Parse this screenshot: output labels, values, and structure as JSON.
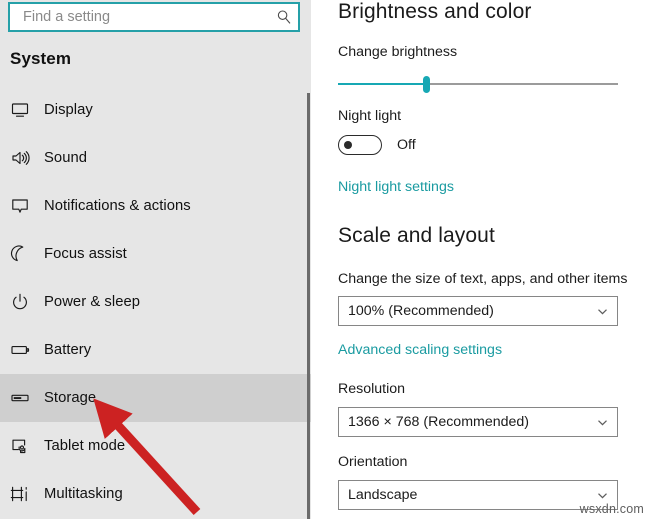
{
  "search": {
    "placeholder": "Find a setting",
    "value": "",
    "icon": "search-icon"
  },
  "sidebar": {
    "header": "System",
    "background_color": "#e6e6e6",
    "selected_background_color": "#cfcfcf",
    "items": [
      {
        "label": "Display",
        "icon": "monitor-icon",
        "selected": false
      },
      {
        "label": "Sound",
        "icon": "speaker-icon",
        "selected": false
      },
      {
        "label": "Notifications & actions",
        "icon": "speech-bubble-icon",
        "selected": false
      },
      {
        "label": "Focus assist",
        "icon": "moon-icon",
        "selected": false
      },
      {
        "label": "Power & sleep",
        "icon": "power-icon",
        "selected": false
      },
      {
        "label": "Battery",
        "icon": "battery-icon",
        "selected": false
      },
      {
        "label": "Storage",
        "icon": "drive-icon",
        "selected": true
      },
      {
        "label": "Tablet mode",
        "icon": "tablet-hand-icon",
        "selected": false
      },
      {
        "label": "Multitasking",
        "icon": "multitasking-icon",
        "selected": false
      }
    ]
  },
  "content": {
    "accent_color": "#17a8b4",
    "link_color": "#1a9ba1",
    "brightness_section": {
      "title": "Brightness and color",
      "slider_label": "Change brightness",
      "slider_percent": 32,
      "night_light_label": "Night light",
      "night_light_state": "Off",
      "night_light_on": false,
      "night_light_link": "Night light settings"
    },
    "scale_section": {
      "title": "Scale and layout",
      "scale_label": "Change the size of text, apps, and other items",
      "scale_value": "100% (Recommended)",
      "advanced_link": "Advanced scaling settings",
      "resolution_label": "Resolution",
      "resolution_value": "1366 × 768 (Recommended)",
      "orientation_label": "Orientation",
      "orientation_value": "Landscape"
    }
  },
  "annotation": {
    "arrow_color": "#cc2222",
    "points_at": "Storage"
  },
  "watermark": "wsxdn.com"
}
